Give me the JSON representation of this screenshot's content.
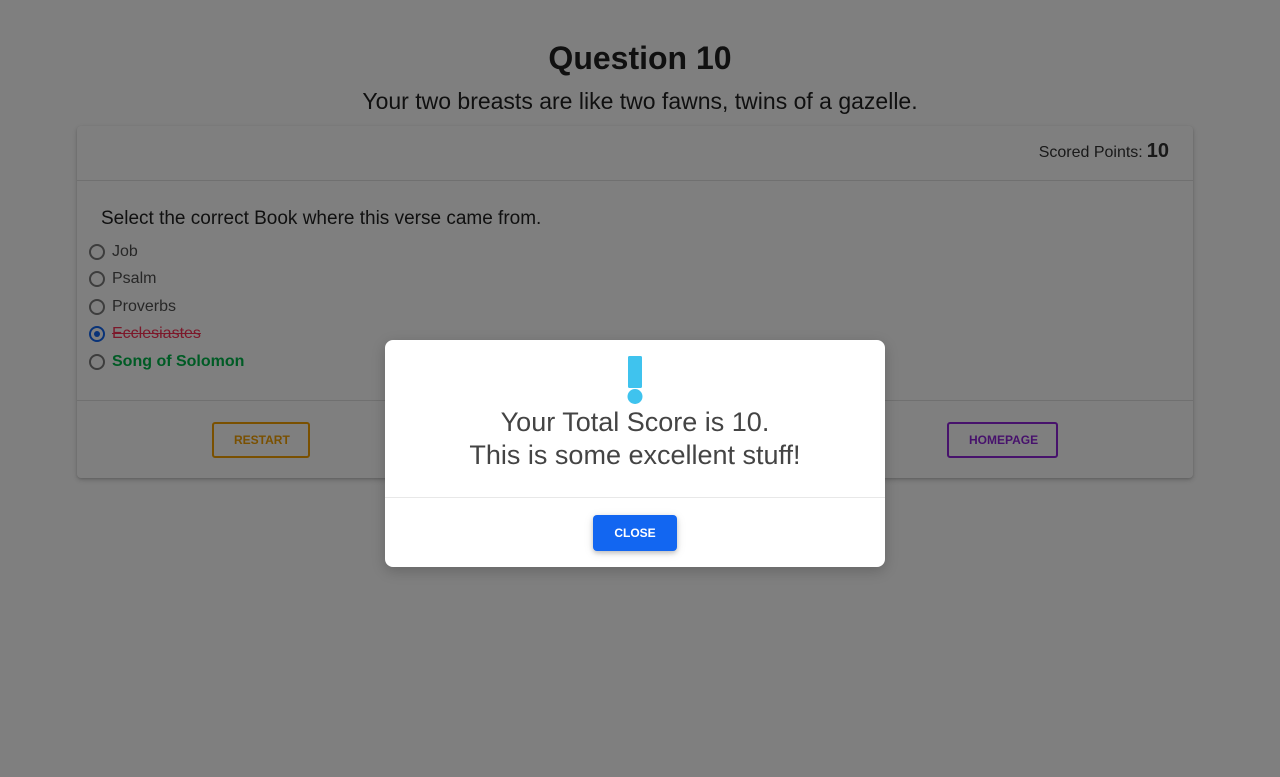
{
  "question": {
    "title": "Question 10",
    "verse": "Your two breasts are like two fawns, twins of a gazelle."
  },
  "card": {
    "score_label": "Scored Points:",
    "score_value": "10",
    "instruction": "Select the correct Book where this verse came from.",
    "options": [
      {
        "label": "Job",
        "state": "unselected"
      },
      {
        "label": "Psalm",
        "state": "unselected"
      },
      {
        "label": "Proverbs",
        "state": "unselected"
      },
      {
        "label": "Ecclesiastes",
        "state": "selected-wrong"
      },
      {
        "label": "Song of Solomon",
        "state": "correct"
      }
    ],
    "restart_label": "RESTART",
    "homepage_label": "HOMEPAGE"
  },
  "modal": {
    "icon": "exclamation-icon",
    "line1": "Your Total Score is 10.",
    "line2": "This is some excellent stuff!",
    "close_label": "CLOSE"
  },
  "colors": {
    "primary": "#1266f1",
    "warning": "#f4a000",
    "secondary": "#8e24d8",
    "danger": "#f93154",
    "success": "#00b74a",
    "icon": "#3fc3ee"
  }
}
